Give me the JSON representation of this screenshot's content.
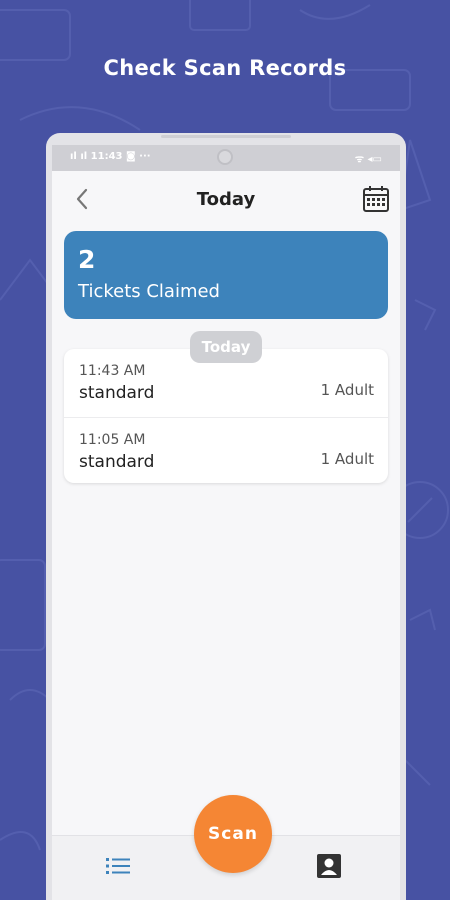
{
  "headline": "Check Scan Records",
  "status_bar": {
    "left": "ıl ıl 11:43 ◙ ···",
    "right": "ᯤ ◂▭"
  },
  "nav": {
    "title": "Today",
    "back_icon": "chevron-left-icon",
    "calendar_icon": "calendar-icon"
  },
  "summary": {
    "count": "2",
    "label": "Tickets Claimed"
  },
  "date_pill": "Today",
  "records": [
    {
      "time": "11:43 AM",
      "type": "standard",
      "quantity": "1 Adult"
    },
    {
      "time": "11:05 AM",
      "type": "standard",
      "quantity": "1 Adult"
    }
  ],
  "scan_button": "Scan",
  "tabs": {
    "list_icon": "list-icon",
    "profile_icon": "profile-icon"
  },
  "colors": {
    "background": "#4752a3",
    "summary_card": "#3d83bb",
    "scan_button": "#f58634",
    "active_tab": "#3d83bb"
  }
}
